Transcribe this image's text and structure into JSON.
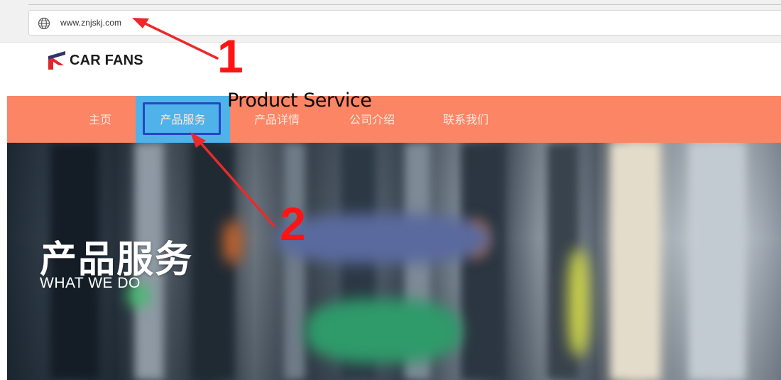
{
  "browser": {
    "url": "www.znjskj.com",
    "address_icon": "globe-icon"
  },
  "site": {
    "logo_text": "CAR FANS",
    "logo_colors": {
      "red": "#e3262b",
      "navy": "#2d3568"
    }
  },
  "nav": {
    "background": "#fb8564",
    "active_background": "#4fb3ea",
    "items": [
      {
        "label": "主页"
      },
      {
        "label": "产品服务",
        "active": true
      },
      {
        "label": "产品详情"
      },
      {
        "label": "公司介绍"
      },
      {
        "label": "联系我们"
      }
    ]
  },
  "hero": {
    "title": "产品服务",
    "subtitle": "WHAT WE DO"
  },
  "annotations": {
    "caption": "Product Service",
    "step_1": "1",
    "step_2": "2",
    "color": "#ff1414",
    "box_color": "#2546c7"
  }
}
